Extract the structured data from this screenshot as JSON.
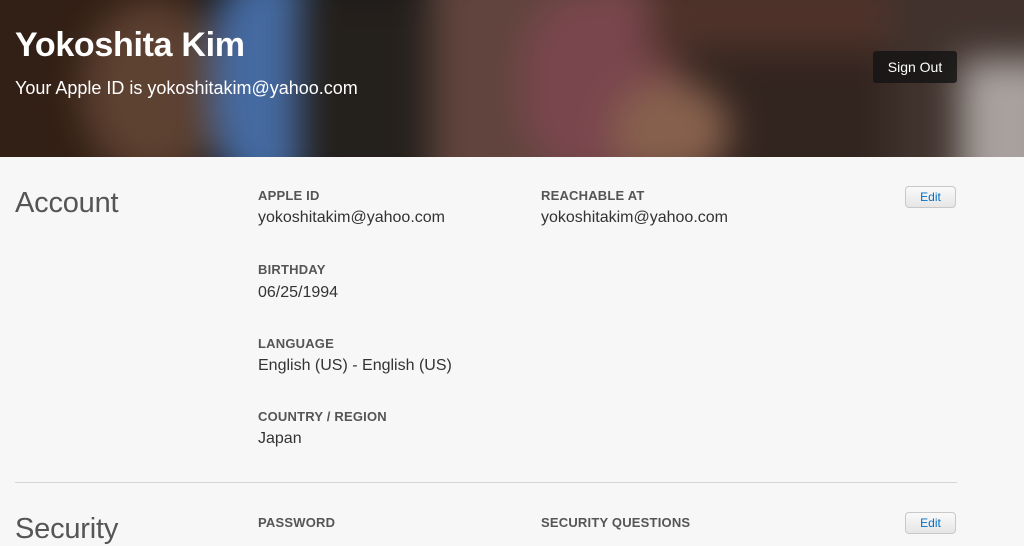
{
  "header": {
    "name": "Yokoshita Kim",
    "subtitle": "Your Apple ID is yokoshitakim@yahoo.com",
    "sign_out_label": "Sign Out"
  },
  "account": {
    "title": "Account",
    "edit_label": "Edit",
    "fields": [
      {
        "label": "APPLE ID",
        "value": "yokoshitakim@yahoo.com"
      },
      {
        "label": "REACHABLE AT",
        "value": "yokoshitakim@yahoo.com"
      },
      {
        "label": "BIRTHDAY",
        "value": "06/25/1994"
      },
      {
        "label": "LANGUAGE",
        "value": "English (US) - English (US)"
      },
      {
        "label": "COUNTRY / REGION",
        "value": "Japan"
      }
    ]
  },
  "security": {
    "title": "Security",
    "edit_label": "Edit",
    "fields": [
      {
        "label": "PASSWORD"
      },
      {
        "label": "SECURITY QUESTIONS"
      }
    ]
  },
  "colors": {
    "link_blue": "#0070c9",
    "page_bg": "#f7f7f7",
    "header_text": "#ffffff"
  }
}
